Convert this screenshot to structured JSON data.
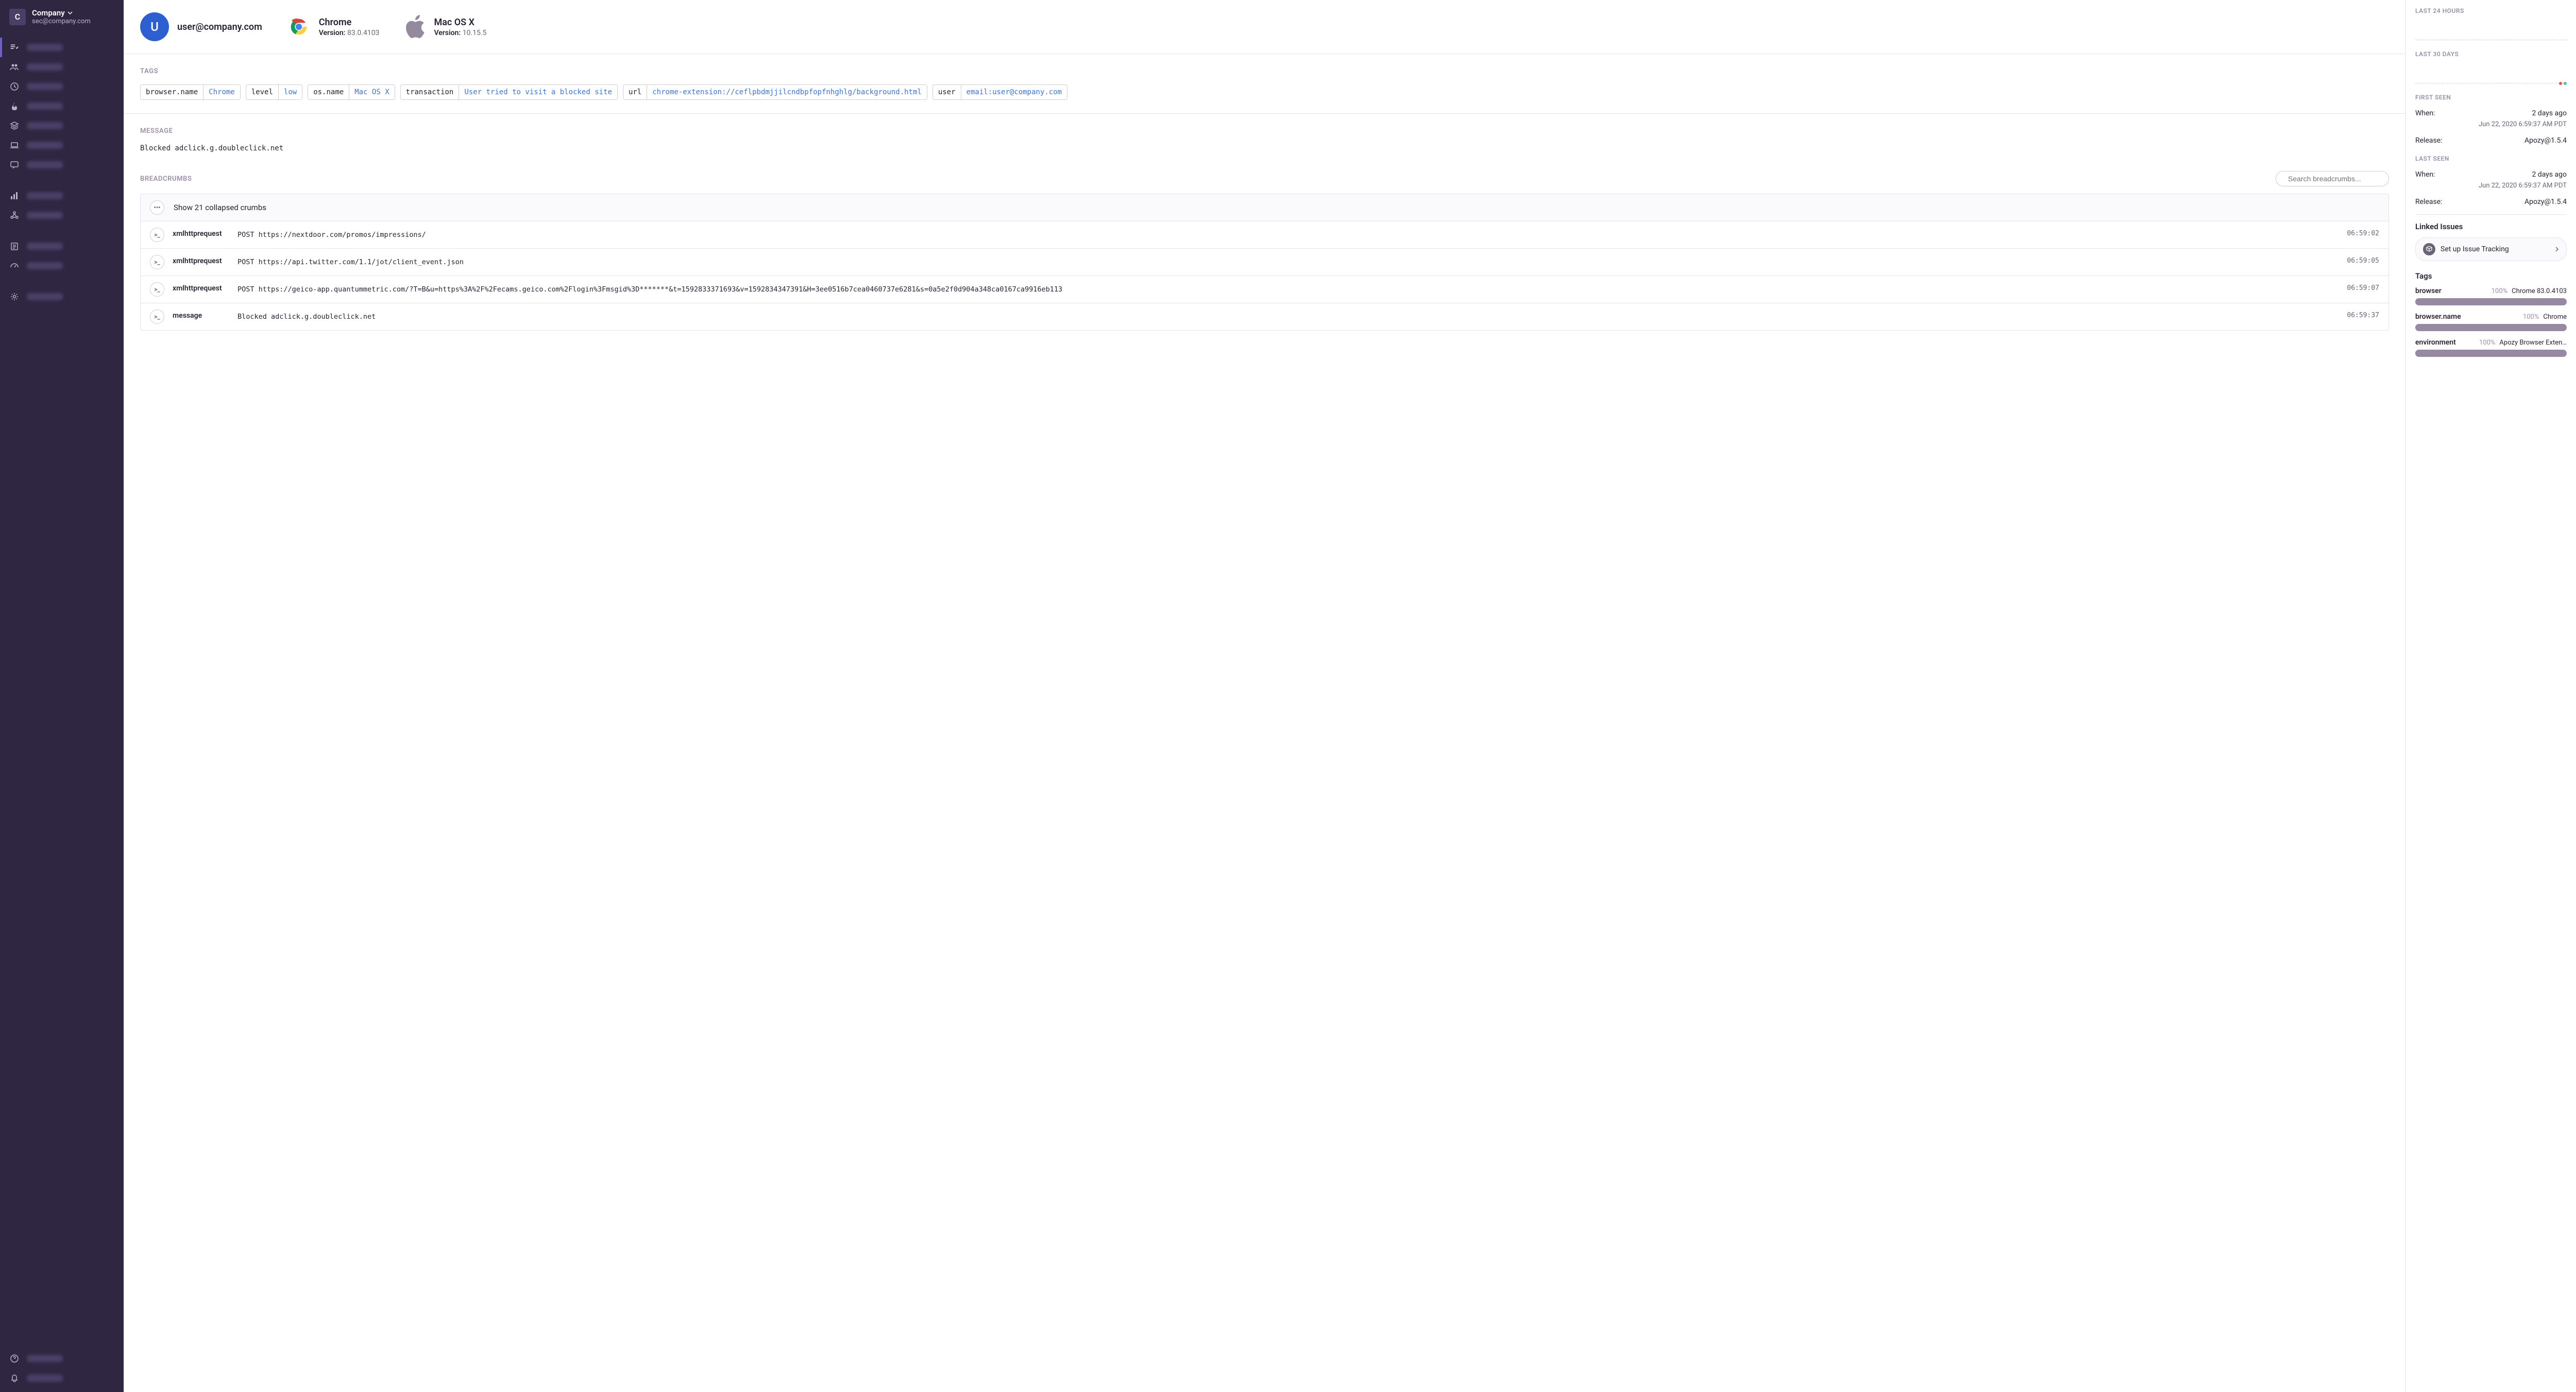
{
  "org": {
    "initial": "C",
    "name": "Company",
    "email": "sec@company.com"
  },
  "header": {
    "user": {
      "initial": "U",
      "email": "user@company.com",
      "avatar_color": "#2d5fd0"
    },
    "browser": {
      "name": "Chrome",
      "version_label": "Version:",
      "version": "83.0.4103"
    },
    "os": {
      "name": "Mac OS X",
      "version_label": "Version:",
      "version": "10.15.5"
    }
  },
  "tags_title": "TAGS",
  "tags": [
    {
      "key": "browser.name",
      "value": "Chrome"
    },
    {
      "key": "level",
      "value": "low"
    },
    {
      "key": "os.name",
      "value": "Mac OS X"
    },
    {
      "key": "transaction",
      "value": "User tried to visit a blocked site"
    },
    {
      "key": "url",
      "value": "chrome-extension://ceflpbdmjjilcndbpfopfnhghlg/background.html"
    },
    {
      "key": "user",
      "value": "email:user@company.com"
    }
  ],
  "message_title": "MESSAGE",
  "message_text": "Blocked adclick.g.doubleclick.net",
  "breadcrumbs_title": "BREADCRUMBS",
  "breadcrumbs_search_placeholder": "Search breadcrumbs...",
  "breadcrumbs_collapsed": "Show 21 collapsed crumbs",
  "breadcrumbs": [
    {
      "category": "xmlhttprequest",
      "desc": "POST https://nextdoor.com/promos/impressions/",
      "time": "06:59:02"
    },
    {
      "category": "xmlhttprequest",
      "desc": "POST https://api.twitter.com/1.1/jot/client_event.json",
      "time": "06:59:05"
    },
    {
      "category": "xmlhttprequest",
      "desc": "POST https://geico-app.quantummetric.com/?T=B&u=https%3A%2F%2Fecams.geico.com%2Flogin%3Fmsgid%3D*******&t=1592833371693&v=1592834347391&H=3ee0516b7cea0460737e6281&s=0a5e2f0d904a348ca0167ca9916eb113",
      "time": "06:59:07"
    },
    {
      "category": "message",
      "desc": "Blocked adclick.g.doubleclick.net",
      "time": "06:59:37"
    }
  ],
  "right": {
    "last24_label": "LAST 24 HOURS",
    "last30_label": "LAST 30 DAYS",
    "first_seen_label": "FIRST SEEN",
    "last_seen_label": "LAST SEEN",
    "when_label": "When:",
    "release_label": "Release:",
    "first_seen": {
      "when": "2 days ago",
      "timestamp": "Jun 22, 2020 6:59:37 AM PDT",
      "release": "Apozy@1.5.4"
    },
    "last_seen": {
      "when": "2 days ago",
      "timestamp": "Jun 22, 2020 6:59:37 AM PDT",
      "release": "Apozy@1.5.4"
    },
    "linked_issues": "Linked Issues",
    "setup_tracking": "Set up Issue Tracking",
    "tags_heading": "Tags",
    "tag_stats": [
      {
        "name": "browser",
        "pct": "100%",
        "value": "Chrome 83.0.4103"
      },
      {
        "name": "browser.name",
        "pct": "100%",
        "value": "Chrome"
      },
      {
        "name": "environment",
        "pct": "100%",
        "value": "Apozy Browser Exten…"
      }
    ]
  }
}
